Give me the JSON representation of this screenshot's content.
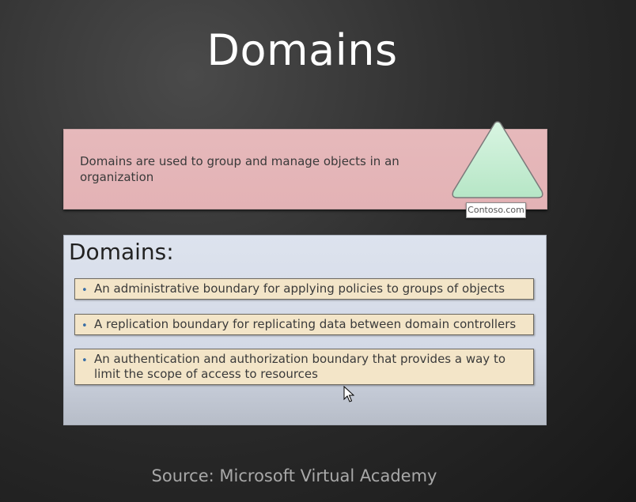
{
  "slide": {
    "title": "Domains",
    "intro": "Domains are used to group and manage objects in an organization",
    "domain_label": "Contoso.com",
    "list_heading": "Domains:",
    "bullets": [
      "An administrative boundary for applying policies to groups of objects",
      "A replication boundary for replicating data between domain controllers",
      "An authentication and authorization boundary that provides a way to limit the scope of access to resources"
    ],
    "source": "Source: Microsoft Virtual Academy"
  },
  "colors": {
    "background": "#2e2e2e",
    "intro_box": "#e4b6b8",
    "triangle": "#c5ecd2",
    "list_panel": "#d6dce8",
    "bullet_box": "#f3e5c8",
    "bullet_dot": "#3a6ea5"
  },
  "icons": {
    "domain": "triangle-domain-icon",
    "cursor": "mouse-pointer-icon"
  }
}
